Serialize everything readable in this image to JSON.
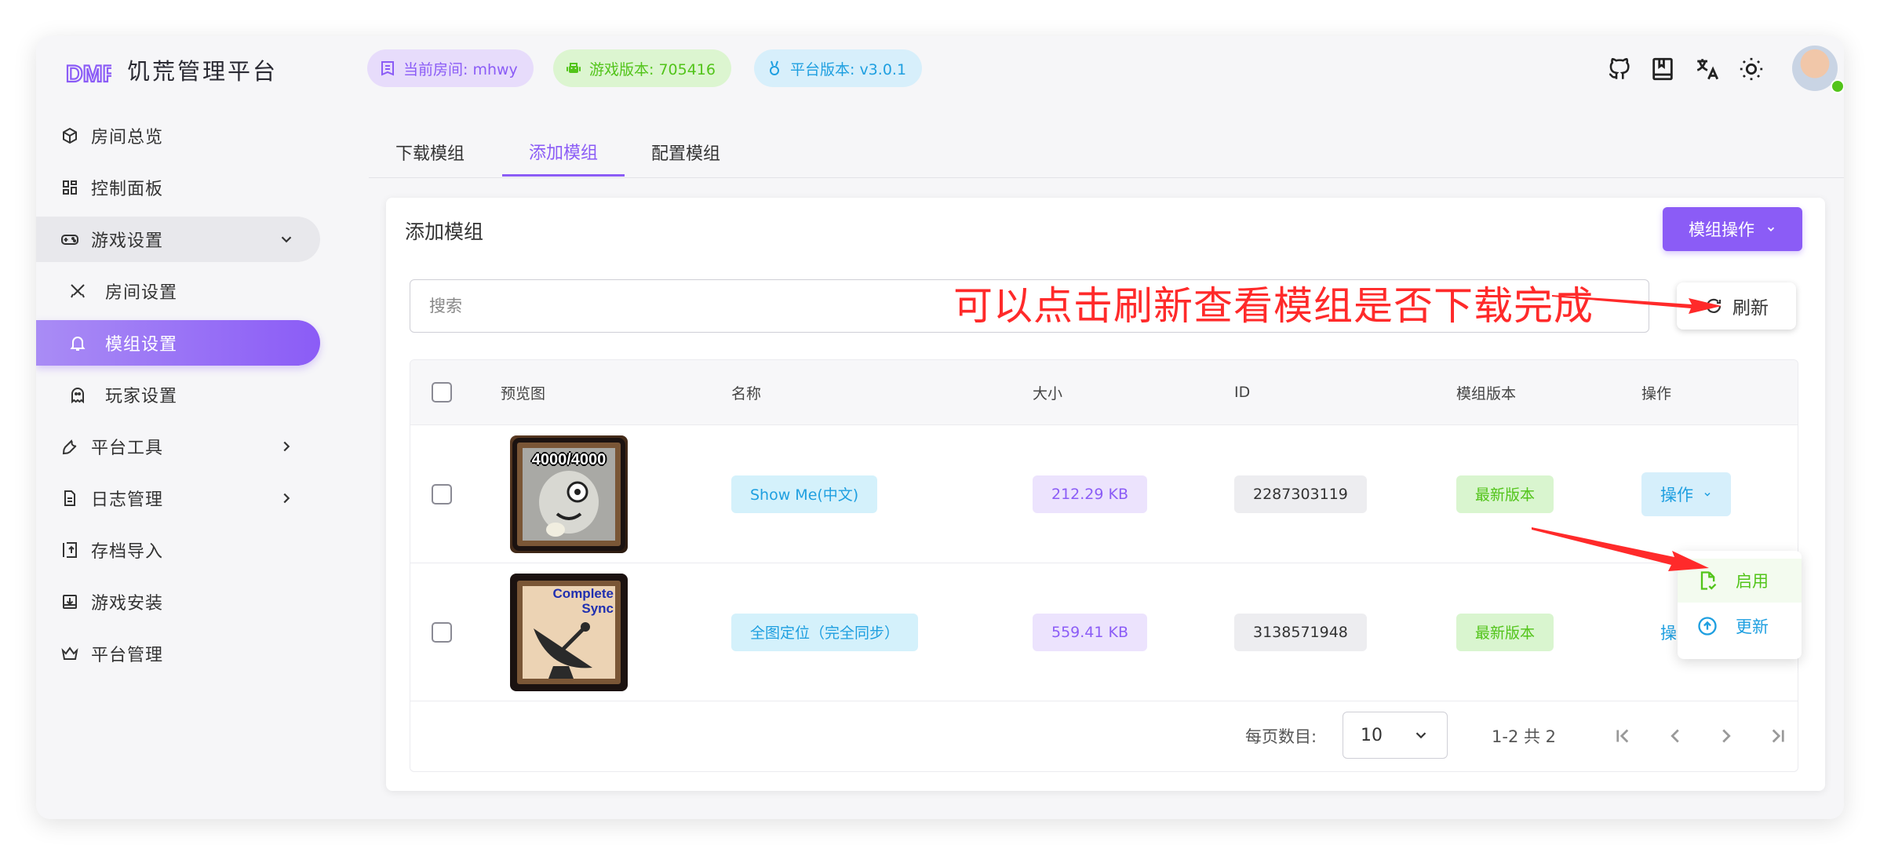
{
  "app": {
    "brand": "饥荒管理平台"
  },
  "header": {
    "badges": [
      {
        "label": "当前房间: mhwy",
        "color": "#8b5cf6"
      },
      {
        "label": "游戏版本: 705416",
        "color": "#52c41a"
      },
      {
        "label": "平台版本: v3.0.1",
        "color": "#1e9fe0"
      }
    ],
    "tools": [
      "github-icon",
      "book-icon",
      "translate-icon",
      "sun-icon"
    ]
  },
  "sidebar": {
    "items": [
      {
        "label": "房间总览",
        "icon": "cube-icon"
      },
      {
        "label": "控制面板",
        "icon": "dashboard-icon"
      },
      {
        "label": "游戏设置",
        "icon": "gamepad-icon",
        "expanded": true
      },
      {
        "label": "房间设置",
        "icon": "swords-icon"
      },
      {
        "label": "模组设置",
        "icon": "bell-icon",
        "active": true
      },
      {
        "label": "玩家设置",
        "icon": "ghost-icon"
      },
      {
        "label": "平台工具",
        "icon": "wrench-icon"
      },
      {
        "label": "日志管理",
        "icon": "log-icon"
      },
      {
        "label": "存档导入",
        "icon": "import-icon"
      },
      {
        "label": "游戏安装",
        "icon": "download-box-icon"
      },
      {
        "label": "平台管理",
        "icon": "crown-icon"
      }
    ]
  },
  "tabs": [
    {
      "label": "下载模组"
    },
    {
      "label": "添加模组",
      "active": true
    },
    {
      "label": "配置模组"
    }
  ],
  "card": {
    "title": "添加模组",
    "mod_action_label": "模组操作",
    "search_placeholder": "搜索",
    "refresh_label": "刷新",
    "annotation": "可以点击刷新查看模组是否下载完成"
  },
  "table": {
    "columns": [
      "预览图",
      "名称",
      "大小",
      "ID",
      "模组版本",
      "操作"
    ],
    "rows": [
      {
        "thumb_text": "4000/4000",
        "name": "Show Me(中文)",
        "size": "212.29 KB",
        "id": "2287303119",
        "version": "最新版本",
        "action": "操作"
      },
      {
        "thumb_text": "Complete Sync",
        "name": "全图定位（完全同步）",
        "size": "559.41 KB",
        "id": "3138571948",
        "version": "最新版本",
        "action": "操作"
      }
    ]
  },
  "pagination": {
    "per_page_label": "每页数目:",
    "per_page_value": "10",
    "range_label": "1-2 共 2"
  },
  "dropdown": {
    "items": [
      {
        "label": "启用",
        "color": "#52c41a"
      },
      {
        "label": "更新",
        "color": "#1e9fe0"
      }
    ]
  }
}
